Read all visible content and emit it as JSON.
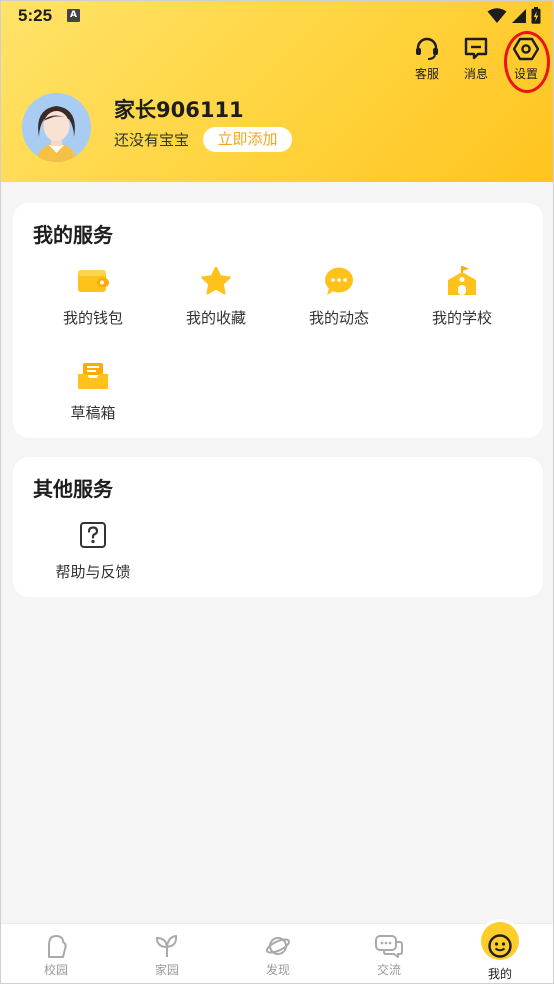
{
  "status_bar": {
    "time": "5:25",
    "notification_badge": "A"
  },
  "header": {
    "actions": [
      {
        "id": "customer-service",
        "label": "客服",
        "icon": "headset-icon"
      },
      {
        "id": "messages",
        "label": "消息",
        "icon": "message-icon"
      },
      {
        "id": "settings",
        "label": "设置",
        "icon": "settings-hexagon-icon"
      }
    ],
    "profile": {
      "username": "家长906111",
      "child_status": "还没有宝宝",
      "add_button": "立即添加"
    }
  },
  "my_services": {
    "title": "我的服务",
    "items": [
      {
        "label": "我的钱包",
        "icon": "wallet-icon"
      },
      {
        "label": "我的收藏",
        "icon": "star-icon"
      },
      {
        "label": "我的动态",
        "icon": "chat-bubble-icon"
      },
      {
        "label": "我的学校",
        "icon": "school-icon"
      },
      {
        "label": "草稿箱",
        "icon": "drafts-tray-icon"
      }
    ]
  },
  "other_services": {
    "title": "其他服务",
    "items": [
      {
        "label": "帮助与反馈",
        "icon": "help-question-icon"
      }
    ]
  },
  "tab_bar": {
    "tabs": [
      {
        "label": "校园",
        "icon": "campus-icon",
        "active": false
      },
      {
        "label": "家园",
        "icon": "sprout-icon",
        "active": false
      },
      {
        "label": "发现",
        "icon": "planet-icon",
        "active": false
      },
      {
        "label": "交流",
        "icon": "chat-icon",
        "active": false
      },
      {
        "label": "我的",
        "icon": "smiley-face-icon",
        "active": true
      }
    ]
  },
  "colors": {
    "header_yellow": "#ffd33d",
    "accent_orange": "#f5a51b",
    "icon_yellow": "#ffc21a",
    "highlight_red": "#e8141a"
  }
}
